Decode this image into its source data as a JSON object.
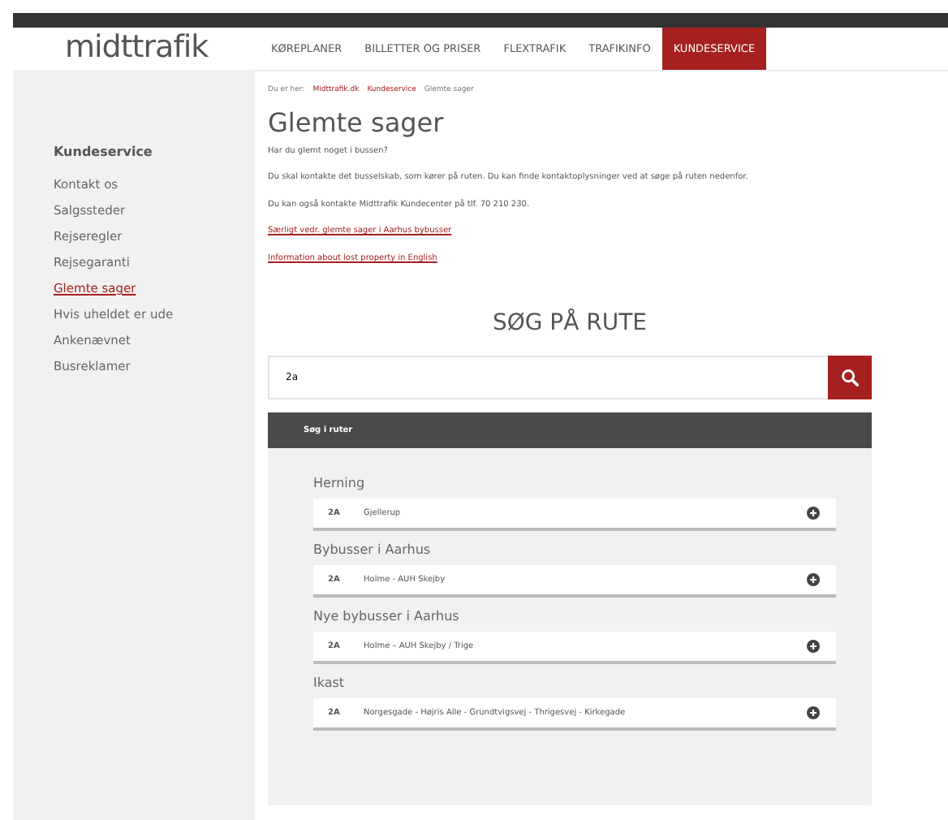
{
  "logo": "midttrafik",
  "nav": [
    {
      "label": "KØREPLANER",
      "selected": false
    },
    {
      "label": "BILLETTER OG PRISER",
      "selected": false
    },
    {
      "label": "FLEXTRAFIK",
      "selected": false
    },
    {
      "label": "TRAFIKINFO",
      "selected": false
    },
    {
      "label": "KUNDESERVICE",
      "selected": true
    }
  ],
  "breadcrumb": {
    "label": "Du er her:",
    "items": [
      {
        "text": "Midttrafik.dk",
        "link": true
      },
      {
        "text": "Kundeservice",
        "link": true
      },
      {
        "text": "Glemte sager",
        "link": false
      }
    ]
  },
  "sidebar": {
    "title": "Kundeservice",
    "items": [
      {
        "label": "Kontakt os",
        "selected": false
      },
      {
        "label": "Salgssteder",
        "selected": false
      },
      {
        "label": "Rejseregler",
        "selected": false
      },
      {
        "label": "Rejsegaranti",
        "selected": false
      },
      {
        "label": "Glemte sager",
        "selected": true
      },
      {
        "label": "Hvis uheldet er ude",
        "selected": false
      },
      {
        "label": "Ankenævnet",
        "selected": false
      },
      {
        "label": "Busreklamer",
        "selected": false
      }
    ]
  },
  "page": {
    "title": "Glemte sager",
    "paragraphs": [
      "Har du glemt noget i bussen?",
      "Du skal kontakte det busselskab, som kører på ruten.  Du kan finde kontaktoplysninger ved at søge på ruten nedenfor.",
      "Du kan også kontakte Midttrafik Kundecenter på tlf. 70 210 230."
    ],
    "links": [
      "Særligt vedr. glemte sager i Aarhus bybusser",
      "Information about lost property in English"
    ]
  },
  "search": {
    "title": "SØG PÅ RUTE",
    "value": "2a",
    "results_header": "Søg i ruter",
    "groups": [
      {
        "name": "Herning",
        "routes": [
          {
            "number": "2A",
            "name": "Gjellerup"
          }
        ]
      },
      {
        "name": "Bybusser i Aarhus",
        "routes": [
          {
            "number": "2A",
            "name": "Holme - AUH Skejby"
          }
        ]
      },
      {
        "name": "Nye bybusser i Aarhus",
        "routes": [
          {
            "number": "2A",
            "name": "Holme – AUH Skejby / Trige"
          }
        ]
      },
      {
        "name": "Ikast",
        "routes": [
          {
            "number": "2A",
            "name": "Norgesgade - Højris Alle - Grundtvigsvej - Thrigesvej - Kirkegade"
          }
        ]
      }
    ]
  }
}
